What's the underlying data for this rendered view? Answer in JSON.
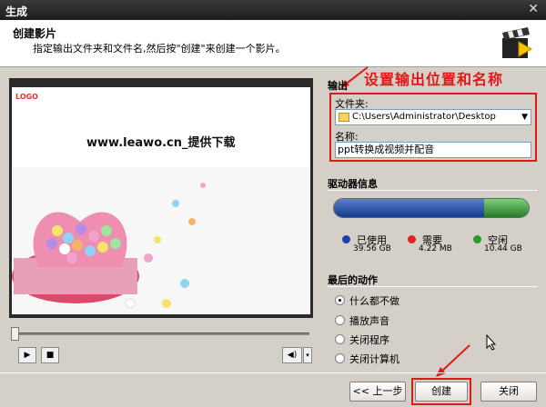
{
  "window": {
    "title": "生成",
    "close_glyph": "✕"
  },
  "header": {
    "title": "创建影片",
    "subtitle": "指定输出文件夹和文件名,然后按\"创建\"来创建一个影片。"
  },
  "preview": {
    "slide_logo": "LOGO",
    "slide_text": "www.leawo.cn_提供下载"
  },
  "player": {
    "play_icon": "▶",
    "stop_icon": "■",
    "volume_icon": "◀)"
  },
  "annotation": "设置输出位置和名称",
  "output": {
    "section_title": "输出",
    "folder_label": "文件夹:",
    "folder_value": "C:\\Users\\Administrator\\Desktop",
    "name_label": "名称:",
    "name_value": "ppt转换成视频并配音"
  },
  "drive": {
    "section_title": "驱动器信息",
    "used_fraction": 0.77,
    "needed_fraction": 0.0,
    "legend": [
      {
        "name": "已使用",
        "value": "39.56 GB",
        "color": "#1f3fa8"
      },
      {
        "name": "需要",
        "value": "4.22 MB",
        "color": "#d22"
      },
      {
        "name": "空闲",
        "value": "10.44 GB",
        "color": "#2a9a2a"
      }
    ]
  },
  "final_action": {
    "section_title": "最后的动作",
    "options": [
      "什么都不做",
      "播放声音",
      "关闭程序",
      "关闭计算机"
    ],
    "selected_index": 0
  },
  "buttons": {
    "back": "<< 上一步",
    "create": "创建",
    "close": "关闭"
  },
  "colors": {
    "accent_red": "#e01818"
  }
}
